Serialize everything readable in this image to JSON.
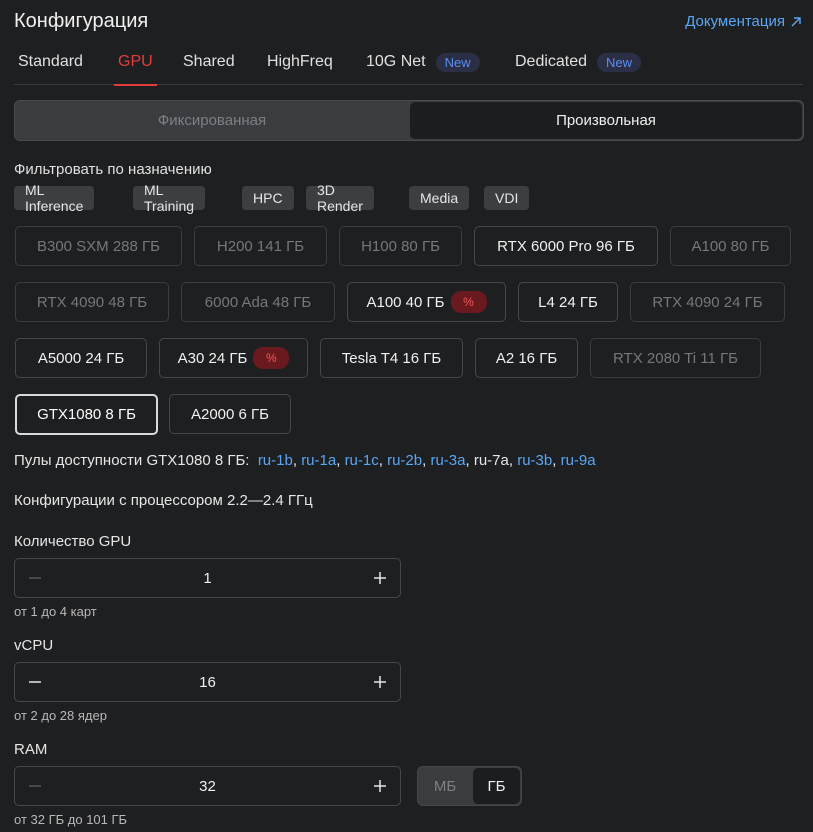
{
  "header": {
    "title": "Конфигурация",
    "doc_link": "Документация"
  },
  "tabs": [
    {
      "label": "Standard",
      "badge": ""
    },
    {
      "label": "GPU",
      "badge": ""
    },
    {
      "label": "Shared",
      "badge": ""
    },
    {
      "label": "HighFreq",
      "badge": ""
    },
    {
      "label": "10G Net",
      "badge": "New"
    },
    {
      "label": "Dedicated",
      "badge": "New"
    }
  ],
  "segment": {
    "fixed": "Фиксированная",
    "custom": "Произвольная",
    "selected": "custom"
  },
  "filter": {
    "label": "Фильтровать по назначению",
    "chips": [
      "ML Inference",
      "ML Training",
      "HPC",
      "3D Render",
      "Media",
      "VDI"
    ]
  },
  "gpus": [
    {
      "label": "B300 SXM 288 ГБ",
      "state": "dim",
      "discount": ""
    },
    {
      "label": "H200 141 ГБ",
      "state": "dim",
      "discount": ""
    },
    {
      "label": "H100 80 ГБ",
      "state": "dim",
      "discount": ""
    },
    {
      "label": "RTX 6000 Pro 96 ГБ",
      "state": "bright",
      "discount": ""
    },
    {
      "label": "A100 80 ГБ",
      "state": "dim",
      "discount": ""
    },
    {
      "label": "RTX 4090 48 ГБ",
      "state": "dim",
      "discount": ""
    },
    {
      "label": "6000 Ada 48 ГБ",
      "state": "dim",
      "discount": ""
    },
    {
      "label": "A100 40 ГБ",
      "state": "bright",
      "discount": "%"
    },
    {
      "label": "L4 24 ГБ",
      "state": "bright",
      "discount": ""
    },
    {
      "label": "RTX 4090 24 ГБ",
      "state": "dim",
      "discount": ""
    },
    {
      "label": "A5000 24 ГБ",
      "state": "bright",
      "discount": ""
    },
    {
      "label": "A30 24 ГБ",
      "state": "bright",
      "discount": "%"
    },
    {
      "label": "Tesla T4 16 ГБ",
      "state": "bright",
      "discount": ""
    },
    {
      "label": "A2 16 ГБ",
      "state": "bright",
      "discount": ""
    },
    {
      "label": "RTX 2080 Ti 11 ГБ",
      "state": "dim",
      "discount": ""
    },
    {
      "label": "GTX1080 8 ГБ",
      "state": "selected",
      "discount": ""
    },
    {
      "label": "A2000 6 ГБ",
      "state": "bright",
      "discount": ""
    }
  ],
  "pools": {
    "prefix": "Пулы доступности GTX1080 8 ГБ:",
    "items": [
      {
        "name": "ru-1b",
        "link": true
      },
      {
        "name": "ru-1a",
        "link": true
      },
      {
        "name": "ru-1c",
        "link": true
      },
      {
        "name": "ru-2b",
        "link": true
      },
      {
        "name": "ru-3a",
        "link": true
      },
      {
        "name": "ru-7a",
        "link": false
      },
      {
        "name": "ru-3b",
        "link": true
      },
      {
        "name": "ru-9a",
        "link": true
      }
    ]
  },
  "cpu_info": "Конфигурации с процессором 2.2—2.4 ГГц",
  "fields": {
    "gpu_count": {
      "label": "Количество GPU",
      "value": "1",
      "hint": "от 1 до 4 карт"
    },
    "vcpu": {
      "label": "vCPU",
      "value": "16",
      "hint": "от 2 до 28 ядер"
    },
    "ram": {
      "label": "RAM",
      "value": "32",
      "hint": "от 32 ГБ до 101 ГБ",
      "units": [
        "МБ",
        "ГБ"
      ],
      "selected_unit": "ГБ"
    }
  },
  "colors": {
    "accent": "#e23c3c",
    "link": "#5aa6f5",
    "background": "#1e1f21",
    "badge_new_text": "#5b8cf2",
    "discount_bg": "#6a1a1e"
  }
}
